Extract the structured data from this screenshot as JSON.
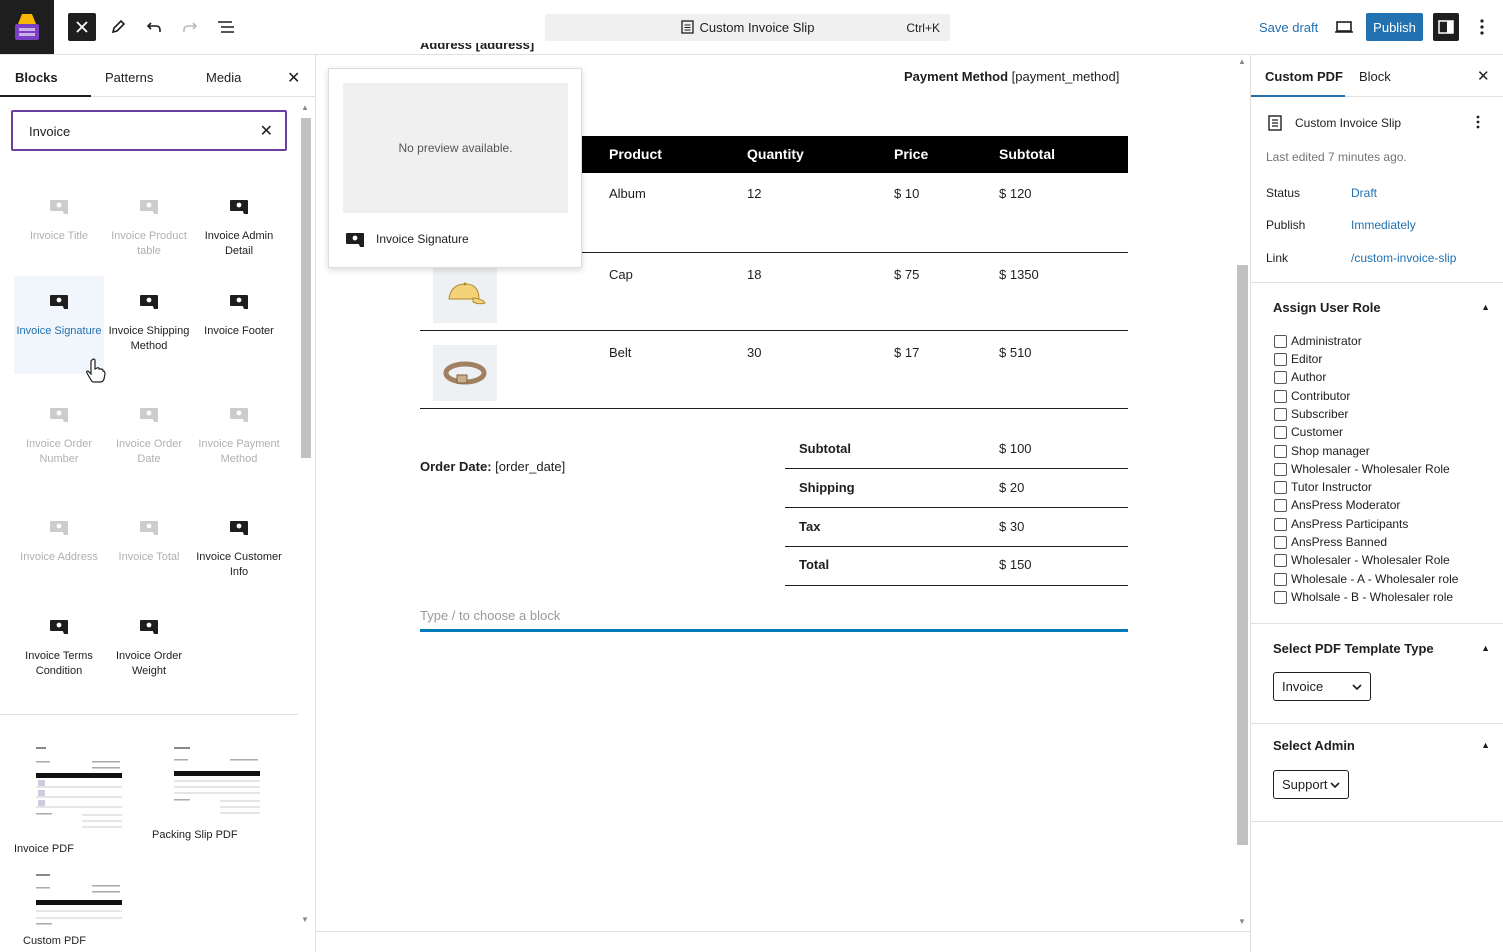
{
  "topbar": {
    "document_title": "Custom Invoice Slip",
    "shortcut": "Ctrl+K",
    "save_draft": "Save draft",
    "publish": "Publish"
  },
  "inserter": {
    "tabs": [
      "Blocks",
      "Patterns",
      "Media"
    ],
    "search_value": "Invoice",
    "blocks": [
      {
        "label": "Invoice Title",
        "disabled": true
      },
      {
        "label": "Invoice Product table",
        "disabled": true
      },
      {
        "label": "Invoice Admin Detail",
        "disabled": false
      },
      {
        "label": "Invoice Signature",
        "disabled": false,
        "selected": true
      },
      {
        "label": "Invoice Shipping Method",
        "disabled": false
      },
      {
        "label": "Invoice Footer",
        "disabled": false
      },
      {
        "label": "Invoice Order Number",
        "disabled": true
      },
      {
        "label": "Invoice Order Date",
        "disabled": true
      },
      {
        "label": "Invoice Payment Method",
        "disabled": true
      },
      {
        "label": "Invoice Address",
        "disabled": true
      },
      {
        "label": "Invoice Total",
        "disabled": true
      },
      {
        "label": "Invoice Customer Info",
        "disabled": false
      },
      {
        "label": "Invoice Terms Condition",
        "disabled": false
      },
      {
        "label": "Invoice Order Weight",
        "disabled": false
      }
    ],
    "patterns": [
      "Invoice PDF",
      "Packing Slip PDF",
      "Custom PDF"
    ]
  },
  "preview": {
    "no_preview": "No preview available.",
    "block_name": "Invoice Signature"
  },
  "document": {
    "address": "Address [address]",
    "payment_label": "Payment Method",
    "payment_value": "[payment_method]",
    "table_headers": [
      "Product",
      "Quantity",
      "Price",
      "Subtotal"
    ],
    "rows": [
      {
        "product": "Album",
        "quantity": "12",
        "price": "$ 10",
        "subtotal": "$ 120"
      },
      {
        "product": "Cap",
        "quantity": "18",
        "price": "$ 75",
        "subtotal": "$ 1350"
      },
      {
        "product": "Belt",
        "quantity": "30",
        "price": "$ 17",
        "subtotal": "$ 510"
      }
    ],
    "order_date_label": "Order Date:",
    "order_date_value": "[order_date]",
    "totals": [
      {
        "label": "Subtotal",
        "value": "$ 100"
      },
      {
        "label": "Shipping",
        "value": "$ 20"
      },
      {
        "label": "Tax",
        "value": "$ 30"
      },
      {
        "label": "Total",
        "value": "$ 150"
      }
    ],
    "placeholder": "Type / to choose a block"
  },
  "sidebar": {
    "tabs": [
      "Custom PDF",
      "Block"
    ],
    "doc_title": "Custom Invoice Slip",
    "last_edited": "Last edited 7 minutes ago.",
    "status_label": "Status",
    "status_value": "Draft",
    "publish_label": "Publish",
    "publish_value": "Immediately",
    "link_label": "Link",
    "link_value": "/custom-invoice-slip",
    "assign_role_title": "Assign User Role",
    "roles": [
      "Administrator",
      "Editor",
      "Author",
      "Contributor",
      "Subscriber",
      "Customer",
      "Shop manager",
      "Wholesaler - Wholesaler Role",
      "Tutor Instructor",
      "AnsPress Moderator",
      "AnsPress Participants",
      "AnsPress Banned",
      "Wholesaler - Wholesaler Role",
      "Wholesale - A - Wholesaler role",
      "Wholsale - B - Wholesaler role"
    ],
    "template_type_title": "Select PDF Template Type",
    "template_type_value": "Invoice",
    "admin_title": "Select Admin",
    "admin_value": "Support"
  },
  "colors": {
    "accent": "#2271b1",
    "search_border": "#6b3fa0",
    "placeholder_line": "#007cba"
  }
}
